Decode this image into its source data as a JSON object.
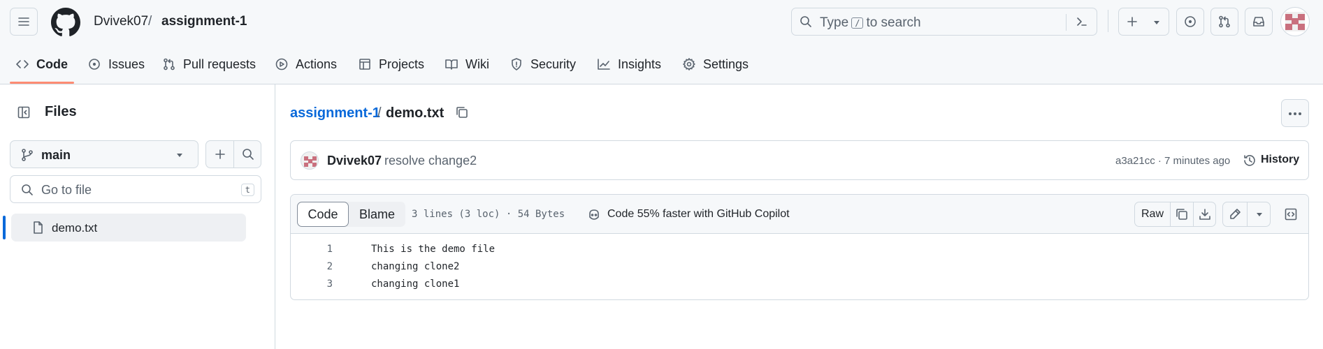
{
  "header": {
    "owner": "Dvivek07",
    "separator": "/",
    "repo": "assignment-1",
    "search": {
      "pre": "Type",
      "key": "/",
      "post": "to search"
    }
  },
  "tabs": [
    {
      "label": "Code",
      "icon": "code-icon",
      "active": true
    },
    {
      "label": "Issues",
      "icon": "issue-opened-icon"
    },
    {
      "label": "Pull requests",
      "icon": "git-pull-request-icon"
    },
    {
      "label": "Actions",
      "icon": "play-icon"
    },
    {
      "label": "Projects",
      "icon": "table-icon"
    },
    {
      "label": "Wiki",
      "icon": "book-icon"
    },
    {
      "label": "Security",
      "icon": "shield-icon"
    },
    {
      "label": "Insights",
      "icon": "graph-icon"
    },
    {
      "label": "Settings",
      "icon": "gear-icon"
    }
  ],
  "sidebar": {
    "title": "Files",
    "branch": "main",
    "goto_placeholder": "Go to file",
    "goto_key": "t",
    "files": [
      {
        "name": "demo.txt",
        "selected": true
      }
    ]
  },
  "path": {
    "repo": "assignment-1",
    "separator": "/",
    "file": "demo.txt"
  },
  "commit": {
    "author": "Dvivek07",
    "message": "resolve change2",
    "meta": "a3a21cc · 7 minutes ago",
    "history_label": "History"
  },
  "file": {
    "code_tab": "Code",
    "blame_tab": "Blame",
    "stats": "3 lines (3 loc) · 54 Bytes",
    "copilot": "Code 55% faster with GitHub Copilot",
    "raw_label": "Raw",
    "lines": [
      {
        "num": "1",
        "text": "This is the demo file"
      },
      {
        "num": "2",
        "text": "changing clone2"
      },
      {
        "num": "3",
        "text": "changing clone1"
      }
    ]
  },
  "colors": {
    "accent_link": "#0969da",
    "tab_underline": "#fd8c73",
    "border": "#d1d9e0",
    "muted": "#59636e",
    "avatar": "#c9707e"
  }
}
